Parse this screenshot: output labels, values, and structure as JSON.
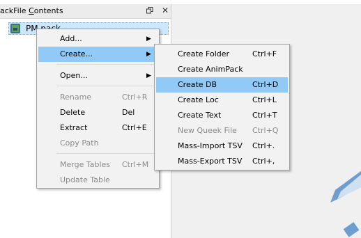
{
  "panel": {
    "title_prefix": "ackFile ",
    "title_underlined": "C",
    "title_suffix": "ontents",
    "restore_icon": "restore-window-icon",
    "close_symbol": "✕"
  },
  "tree": {
    "item_label": "PM.pack"
  },
  "context_menu": {
    "add": "Add...",
    "create": "Create...",
    "open": "Open...",
    "rename": "Rename",
    "rename_sc": "Ctrl+R",
    "delete": "Delete",
    "delete_sc": "Del",
    "extract": "Extract",
    "extract_sc": "Ctrl+E",
    "copy_path": "Copy Path",
    "merge_tables": "Merge Tables",
    "merge_tables_sc": "Ctrl+M",
    "update_table": "Update Table"
  },
  "create_submenu": {
    "create_folder": "Create Folder",
    "create_folder_sc": "Ctrl+F",
    "create_animpack": "Create AnimPack",
    "create_db": "Create DB",
    "create_db_sc": "Ctrl+D",
    "create_loc": "Create Loc",
    "create_loc_sc": "Ctrl+L",
    "create_text": "Create Text",
    "create_text_sc": "Ctrl+T",
    "new_queek_file": "New Queek File",
    "new_queek_file_sc": "Ctrl+Q",
    "mass_import_tsv": "Mass-Import TSV",
    "mass_import_tsv_sc": "Ctrl+.",
    "mass_export_tsv": "Mass-Export TSV",
    "mass_export_tsv_sc": "Ctrl+,"
  },
  "colors": {
    "highlight": "#91c9f7",
    "selection": "#cce8ff",
    "disabled_text": "#8a8a8a",
    "decor_blue": "#6e9ecf"
  }
}
